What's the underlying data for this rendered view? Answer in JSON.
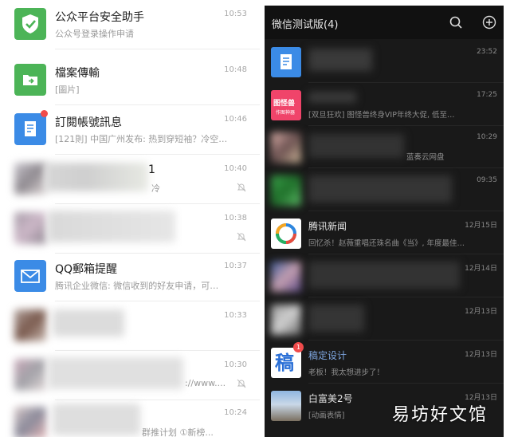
{
  "left_list": {
    "rows": [
      {
        "title": "公众平台安全助手",
        "sub": "公众号登录操作申请",
        "time": "10:53",
        "icon": "shield-icon"
      },
      {
        "title": "檔案傳輸",
        "sub": "[圖片]",
        "time": "10:48",
        "icon": "folder-transfer-icon"
      },
      {
        "title": "訂閱帳號訊息",
        "sub": "[121則] 中国广州发布: 热到穿短袖？冷空…",
        "time": "10:46",
        "icon": "subscription-doc-icon"
      },
      {
        "title": "1",
        "sub": "冷",
        "time": "10:40",
        "icon": "blurred-avatar"
      },
      {
        "title": "",
        "sub": "",
        "time": "10:38",
        "icon": "blurred-avatar"
      },
      {
        "title": "QQ郵箱提醒",
        "sub": "腾讯企业微信: 微信收到的好友申请，可…",
        "time": "10:37",
        "icon": "mail-icon"
      },
      {
        "title": "",
        "sub": "",
        "time": "10:33",
        "icon": "blurred-avatar"
      },
      {
        "title": "",
        "sub": "://www....",
        "time": "10:30",
        "icon": "blurred-avatar"
      },
      {
        "title": "",
        "sub": "群推计划 ①新榜...",
        "time": "10:24",
        "icon": "blurred-avatar"
      }
    ]
  },
  "right_panel": {
    "header_title": "微信测试版(4)",
    "rows": [
      {
        "title": "",
        "sub": "",
        "time": "23:52"
      },
      {
        "title": "",
        "sub": "[双旦狂欢] 图怪兽终身VIP年终大促, 低至…",
        "time": "17:25",
        "avatar_text": "图怪兽",
        "avatar_sub": "作图神器"
      },
      {
        "title": "",
        "sub": "蓝奏云网盘",
        "time": "10:29"
      },
      {
        "title": "",
        "sub": "",
        "time": "09:35"
      },
      {
        "title": "腾讯新闻",
        "sub": "回忆杀！赵薇重唱还珠名曲《当》, 年度最佳…",
        "time": "12月15日"
      },
      {
        "title": "",
        "sub": "",
        "time": "12月14日"
      },
      {
        "title": "",
        "sub": "",
        "time": "12月13日"
      },
      {
        "title": "稿定设计",
        "sub": "老板！我太想进步了！",
        "time": "12月13日",
        "avatar_text": "稿",
        "badge": "1"
      },
      {
        "title": "白富美2号",
        "sub": "[动画表情]",
        "time": "12月13日"
      }
    ]
  },
  "watermark": "易坊好文馆",
  "colors": {
    "wechat_green": "#4cb457",
    "blue_accent": "#3b8be6",
    "dark_bg": "#191919",
    "badge_red": "#f04b4b"
  }
}
